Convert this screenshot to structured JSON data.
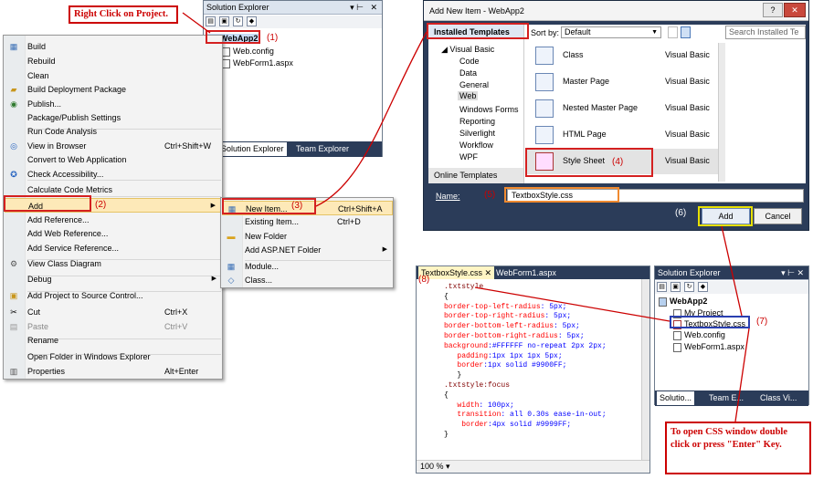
{
  "callouts": {
    "right_click": "Right Click on Project.",
    "open_css": "To open CSS window double click or press \"Enter\" Key."
  },
  "steps": [
    "(1)",
    "(2)",
    "(3)",
    "(4)",
    "(5)",
    "(6)",
    "(7)",
    "(8)"
  ],
  "solution_explorer_1": {
    "title": "Solution Explorer",
    "project": "WebApp2",
    "files": [
      "Web.config",
      "WebForm1.aspx"
    ],
    "tabs": [
      "Solution Explorer",
      "Team Explorer"
    ]
  },
  "context_menu": [
    {
      "label": "Build",
      "shortcut": "",
      "icon": "build-icon"
    },
    {
      "label": "Rebuild",
      "shortcut": "",
      "icon": ""
    },
    {
      "label": "Clean",
      "shortcut": "",
      "icon": ""
    },
    {
      "label": "Build Deployment Package",
      "shortcut": "",
      "icon": "package-icon"
    },
    {
      "label": "Publish...",
      "shortcut": "",
      "icon": "publish-icon"
    },
    {
      "label": "Package/Publish Settings",
      "shortcut": "",
      "icon": ""
    },
    {
      "label": "Run Code Analysis",
      "shortcut": "",
      "icon": ""
    },
    {
      "label": "View in Browser",
      "shortcut": "Ctrl+Shift+W",
      "icon": "browser-icon"
    },
    {
      "label": "Convert to Web Application",
      "shortcut": "",
      "icon": ""
    },
    {
      "label": "Check Accessibility...",
      "shortcut": "",
      "icon": "accessibility-icon"
    },
    {
      "label": "Calculate Code Metrics",
      "shortcut": "",
      "icon": ""
    },
    {
      "label": "Add",
      "shortcut": "",
      "icon": ""
    },
    {
      "label": "Add Reference...",
      "shortcut": "",
      "icon": ""
    },
    {
      "label": "Add Web Reference...",
      "shortcut": "",
      "icon": ""
    },
    {
      "label": "Add Service Reference...",
      "shortcut": "",
      "icon": ""
    },
    {
      "label": "View Class Diagram",
      "shortcut": "",
      "icon": "class-diagram-icon"
    },
    {
      "label": "Debug",
      "shortcut": "",
      "icon": ""
    },
    {
      "label": "Add Project to Source Control...",
      "shortcut": "",
      "icon": "source-control-icon"
    },
    {
      "label": "Cut",
      "shortcut": "Ctrl+X",
      "icon": "cut-icon"
    },
    {
      "label": "Paste",
      "shortcut": "Ctrl+V",
      "icon": "paste-icon"
    },
    {
      "label": "Rename",
      "shortcut": "",
      "icon": ""
    },
    {
      "label": "Open Folder in Windows Explorer",
      "shortcut": "",
      "icon": "folder-icon"
    },
    {
      "label": "Properties",
      "shortcut": "Alt+Enter",
      "icon": "properties-icon"
    }
  ],
  "submenu": [
    {
      "label": "New Item...",
      "shortcut": "Ctrl+Shift+A"
    },
    {
      "label": "Existing Item...",
      "shortcut": "Ctrl+D"
    },
    {
      "label": "New Folder",
      "shortcut": ""
    },
    {
      "label": "Add ASP.NET Folder",
      "shortcut": ""
    },
    {
      "label": "Module...",
      "shortcut": ""
    },
    {
      "label": "Class...",
      "shortcut": ""
    }
  ],
  "dialog": {
    "title": "Add New Item - WebApp2",
    "installed": "Installed Templates",
    "sort_label": "Sort by:",
    "sort_value": "Default",
    "search_placeholder": "Search Installed Te",
    "tree": [
      "Visual Basic",
      "Code",
      "Data",
      "General",
      "Web",
      "Windows Forms",
      "Reporting",
      "Silverlight",
      "Workflow",
      "WPF"
    ],
    "online": "Online Templates",
    "templates": [
      {
        "name": "Class",
        "lang": "Visual Basic"
      },
      {
        "name": "Master Page",
        "lang": "Visual Basic"
      },
      {
        "name": "Nested Master Page",
        "lang": "Visual Basic"
      },
      {
        "name": "HTML Page",
        "lang": "Visual Basic"
      },
      {
        "name": "Style Sheet",
        "lang": "Visual Basic"
      }
    ],
    "name_label": "Name:",
    "name_value": "TextboxStyle.css",
    "add": "Add",
    "cancel": "Cancel"
  },
  "editor": {
    "tabs": [
      "TextboxStyle.css",
      "WebForm1.aspx"
    ],
    "zoom": "100 %",
    "lines": [
      [
        {
          "t": ".txtstyle",
          "c": "sel"
        }
      ],
      [
        {
          "t": "{",
          "c": ""
        }
      ],
      [
        {
          "t": "border-top-left-radius",
          "c": "prop"
        },
        {
          "t": ": 5px;",
          "c": "val"
        }
      ],
      [
        {
          "t": "border-top-right-radius",
          "c": "prop"
        },
        {
          "t": ": 5px;",
          "c": "val"
        }
      ],
      [
        {
          "t": "border-bottom-left-radius",
          "c": "prop"
        },
        {
          "t": ": 5px;",
          "c": "val"
        }
      ],
      [
        {
          "t": "border-bottom-right-radius",
          "c": "prop"
        },
        {
          "t": ": 5px;",
          "c": "val"
        }
      ],
      [
        {
          "t": "background",
          "c": "prop"
        },
        {
          "t": ":#FFFFFF no-repeat 2px 2px;",
          "c": "val"
        }
      ],
      [
        {
          "t": "   padding",
          "c": "prop"
        },
        {
          "t": ":1px 1px 1px 5px;",
          "c": "val"
        }
      ],
      [
        {
          "t": "   border",
          "c": "prop"
        },
        {
          "t": ":1px solid #9900FF;",
          "c": "val"
        }
      ],
      [
        {
          "t": "   }",
          "c": ""
        }
      ],
      [
        {
          "t": ".txtstyle:focus",
          "c": "sel"
        }
      ],
      [
        {
          "t": "{",
          "c": ""
        }
      ],
      [
        {
          "t": "   width",
          "c": "prop"
        },
        {
          "t": ": 100px;",
          "c": "val"
        }
      ],
      [
        {
          "t": "   transition",
          "c": "prop"
        },
        {
          "t": ": all 0.30s ease-in-out;",
          "c": "val"
        }
      ],
      [
        {
          "t": "    border",
          "c": "prop"
        },
        {
          "t": ":4px solid #9999FF;",
          "c": "val"
        }
      ],
      [
        {
          "t": "}",
          "c": ""
        }
      ]
    ]
  },
  "solution_explorer_2": {
    "title": "Solution Explorer",
    "project": "WebApp2",
    "items": [
      "My Project",
      "TextboxStyle.css",
      "Web.config",
      "WebForm1.aspx"
    ],
    "tabs": [
      "Solutio...",
      "Team E...",
      "Class Vi..."
    ]
  }
}
